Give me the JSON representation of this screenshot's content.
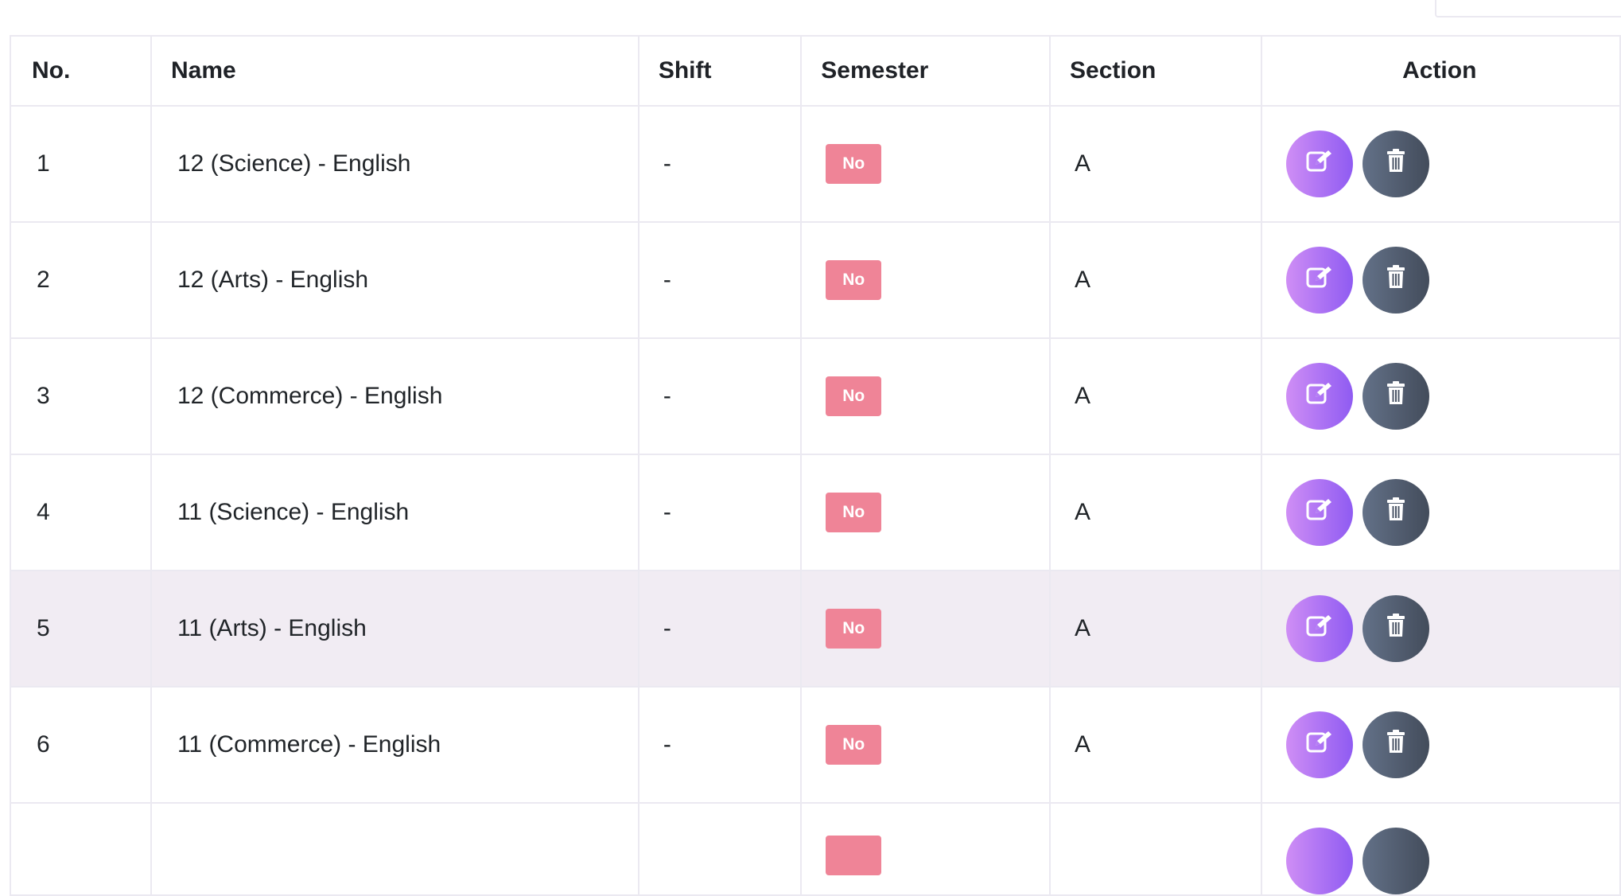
{
  "table": {
    "headers": [
      "No.",
      "Name",
      "Shift",
      "Semester",
      "Section",
      "Action"
    ],
    "rows": [
      {
        "no": "1",
        "name": "12 (Science) - English",
        "shift": "-",
        "semester": "No",
        "section": "A"
      },
      {
        "no": "2",
        "name": "12 (Arts) - English",
        "shift": "-",
        "semester": "No",
        "section": "A"
      },
      {
        "no": "3",
        "name": "12 (Commerce) - English",
        "shift": "-",
        "semester": "No",
        "section": "A"
      },
      {
        "no": "4",
        "name": "11 (Science) - English",
        "shift": "-",
        "semester": "No",
        "section": "A"
      },
      {
        "no": "5",
        "name": "11 (Arts) - English",
        "shift": "-",
        "semester": "No",
        "section": "A"
      },
      {
        "no": "6",
        "name": "11 (Commerce) - English",
        "shift": "-",
        "semester": "No",
        "section": "A"
      }
    ],
    "highlighted_row": 5
  },
  "colors": {
    "badge_no": "#ef8497",
    "edit_gradient": [
      "#cf8ef5",
      "#8f5bf2"
    ],
    "delete_gradient": [
      "#637188",
      "#434c5b"
    ],
    "row_hover": "#f1ecf3",
    "border": "#ebe9f1"
  },
  "icons": {
    "edit": "edit-icon",
    "delete": "trash-icon"
  }
}
